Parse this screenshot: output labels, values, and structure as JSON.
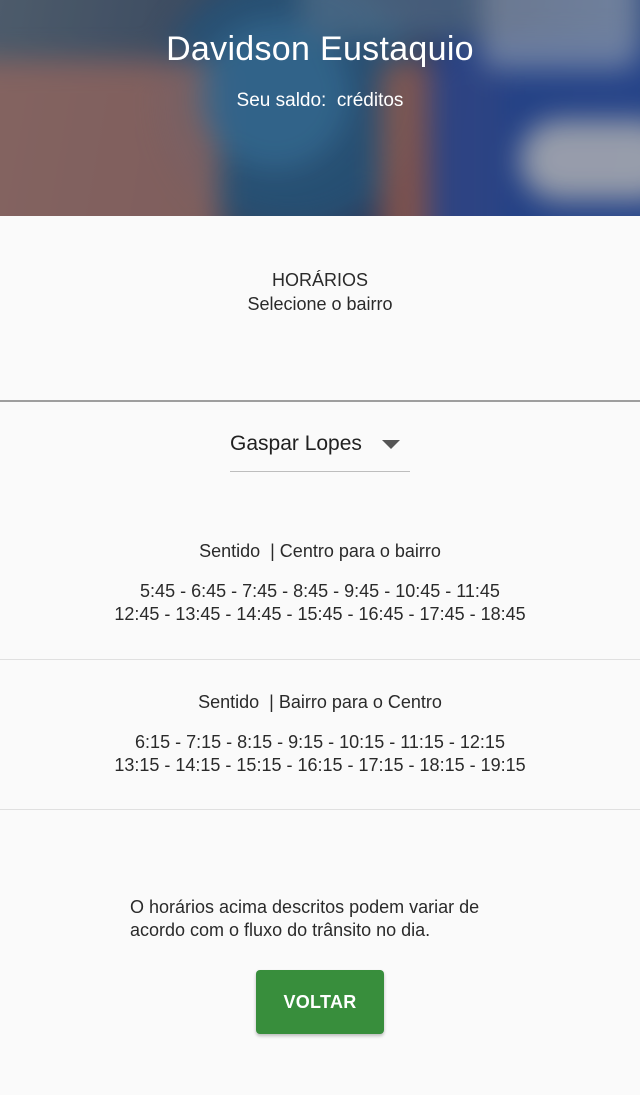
{
  "header": {
    "user_name": "Davidson Eustaquio",
    "balance_label": "Seu saldo:",
    "balance_value": "",
    "balance_unit": "créditos",
    "background_colors": [
      "#2c5e86",
      "#2a4d9e",
      "#b5786a",
      "#d9d6d2"
    ]
  },
  "section": {
    "title": "HORÁRIOS",
    "subtitle": "Selecione o bairro"
  },
  "dropdown": {
    "selected": "Gaspar Lopes",
    "icon": "arrow-drop-down-icon"
  },
  "schedules": [
    {
      "direction": "Sentido  | Centro para o bairro",
      "times_line_1": "5:45 - 6:45 - 7:45 - 8:45 - 9:45 - 10:45 - 11:45",
      "times_line_2": "12:45 - 13:45 - 14:45 - 15:45 - 16:45 - 17:45 - 18:45"
    },
    {
      "direction": "Sentido  | Bairro para o Centro",
      "times_line_1": "6:15 - 7:15 - 8:15 - 9:15 - 10:15 - 11:15 - 12:15",
      "times_line_2": "13:15 - 14:15 - 15:15 - 16:15 - 17:15 - 18:15 - 19:15"
    }
  ],
  "note": "O horários acima descritos podem variar de acordo com o fluxo do trânsito no dia.",
  "actions": {
    "back_label": "VOLTAR",
    "back_color": "#388e3c"
  }
}
